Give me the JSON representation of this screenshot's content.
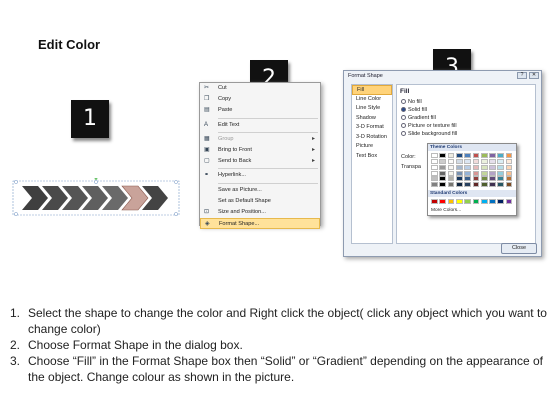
{
  "title": "Edit Color",
  "badges": [
    "1",
    "2",
    "3"
  ],
  "context_menu": {
    "items": [
      {
        "label": "Cut",
        "icon": "scissors-icon",
        "disabled": false,
        "submenu": false
      },
      {
        "label": "Copy",
        "icon": "copy-icon",
        "disabled": false,
        "submenu": false
      },
      {
        "label": "Paste",
        "icon": "paste-icon",
        "disabled": false,
        "submenu": false
      },
      {
        "label": "Edit Text",
        "icon": "edit-text-icon",
        "disabled": false,
        "submenu": false
      },
      {
        "label": "Group",
        "icon": "group-icon",
        "disabled": true,
        "submenu": true
      },
      {
        "label": "Bring to Front",
        "icon": "bring-front-icon",
        "disabled": false,
        "submenu": true
      },
      {
        "label": "Send to Back",
        "icon": "send-back-icon",
        "disabled": false,
        "submenu": true
      },
      {
        "label": "Hyperlink...",
        "icon": "hyperlink-icon",
        "disabled": false,
        "submenu": false
      },
      {
        "label": "Save as Picture...",
        "icon": "",
        "disabled": false,
        "submenu": false
      },
      {
        "label": "Set as Default Shape",
        "icon": "",
        "disabled": false,
        "submenu": false
      },
      {
        "label": "Size and Position...",
        "icon": "size-icon",
        "disabled": false,
        "submenu": false
      },
      {
        "label": "Format Shape...",
        "icon": "format-shape-icon",
        "disabled": false,
        "submenu": false,
        "highlighted": true
      }
    ]
  },
  "dialog": {
    "title": "Format Shape",
    "nav": [
      "Fill",
      "Line Color",
      "Line Style",
      "Shadow",
      "3-D Format",
      "3-D Rotation",
      "Picture",
      "Text Box"
    ],
    "selected_nav": "Fill",
    "pane_heading": "Fill",
    "options": [
      "No fill",
      "Solid fill",
      "Gradient fill",
      "Picture or texture fill",
      "Slide background fill"
    ],
    "selected_option": "Solid fill",
    "color_label": "Color:",
    "transparency_label": "Transpa",
    "close_label": "Close"
  },
  "palette": {
    "theme_label": "Theme Colors",
    "standard_label": "Standard Colors",
    "more_label": "More Colors...",
    "theme_top": [
      "#ffffff",
      "#000000",
      "#eeece1",
      "#1f497d",
      "#4f81bd",
      "#c0504d",
      "#9bbb59",
      "#8064a2",
      "#4bacc6",
      "#f79646"
    ],
    "standard": [
      "#c00000",
      "#ff0000",
      "#ffc000",
      "#ffff00",
      "#92d050",
      "#00b050",
      "#00b0f0",
      "#0070c0",
      "#002060",
      "#7030a0"
    ]
  },
  "instructions": [
    {
      "num": "1.",
      "text": "Select the shape to change the color and Right click the object( click any object which you want to change color)"
    },
    {
      "num": "2.",
      "text": "Choose Format Shape in the dialog box."
    },
    {
      "num": "3.",
      "text": "Choose “Fill” in the Format Shape box then “Solid” or “Gradient” depending on the appearance of the object. Change colour as shown in the picture."
    }
  ]
}
